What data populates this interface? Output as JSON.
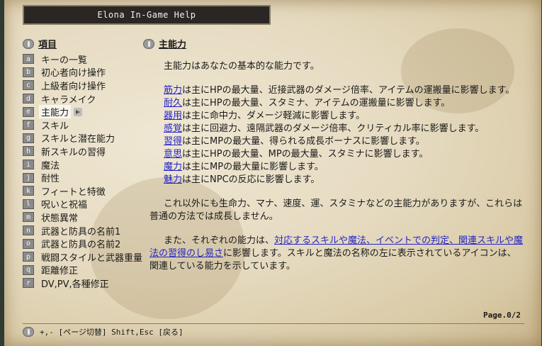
{
  "window": {
    "title": "Elona In-Game Help"
  },
  "left_section": {
    "label": "項目"
  },
  "right_section": {
    "label": "主能力"
  },
  "menu": {
    "items": [
      {
        "key": "a",
        "label": "キーの一覧"
      },
      {
        "key": "b",
        "label": "初心者向け操作"
      },
      {
        "key": "c",
        "label": "上級者向け操作"
      },
      {
        "key": "d",
        "label": "キャラメイク"
      },
      {
        "key": "e",
        "label": "主能力",
        "selected": true
      },
      {
        "key": "f",
        "label": "スキル"
      },
      {
        "key": "g",
        "label": "スキルと潜在能力"
      },
      {
        "key": "h",
        "label": "新スキルの習得"
      },
      {
        "key": "i",
        "label": "魔法"
      },
      {
        "key": "j",
        "label": "耐性"
      },
      {
        "key": "k",
        "label": "フィートと特徴"
      },
      {
        "key": "l",
        "label": "呪いと祝福"
      },
      {
        "key": "m",
        "label": "状態異常"
      },
      {
        "key": "n",
        "label": "武器と防具の名前1"
      },
      {
        "key": "o",
        "label": "武器と防具の名前2"
      },
      {
        "key": "p",
        "label": "戦闘スタイルと武器重量"
      },
      {
        "key": "q",
        "label": "距離修正"
      },
      {
        "key": "r",
        "label": "DV,PV,各種修正"
      }
    ]
  },
  "content": {
    "intro": "主能力はあなたの基本的な能力です。",
    "stats": [
      {
        "name": "筋力",
        "text": "は主にHPの最大量、近接武器のダメージ倍率、アイテムの運搬量に影響します。"
      },
      {
        "name": "耐久",
        "text": "は主にHPの最大量、スタミナ、アイテムの運搬量に影響します。"
      },
      {
        "name": "器用",
        "text": "は主に命中力、ダメージ軽減に影響します。"
      },
      {
        "name": "感覚",
        "text": "は主に回避力、遠隔武器のダメージ倍率、クリティカル率に影響します。"
      },
      {
        "name": "習得",
        "text": "は主にMPの最大量、得られる成長ボーナスに影響します。"
      },
      {
        "name": "意思",
        "text": "は主にHPの最大量、MPの最大量、スタミナに影響します。"
      },
      {
        "name": "魔力",
        "text": "は主にMPの最大量に影響します。"
      },
      {
        "name": "魅力",
        "text": "は主にNPCの反応に影響します。"
      }
    ],
    "para2": "これ以外にも生命力、マナ、速度、運、スタミナなどの主能力がありますが、これらは普通の方法では成長しません。",
    "para3_before": "また、それぞれの能力は、",
    "para3_link": "対応するスキルや魔法、イベントでの判定、関連スキルや魔法の習得のし易さ",
    "para3_after": "に影響します。スキルと魔法の名称の左に表示されているアイコンは、関連している能力を示しています。"
  },
  "page": {
    "indicator": "Page.0/2"
  },
  "footer": {
    "hint": "+,- [ページ切替]  Shift,Esc [戻る]"
  }
}
